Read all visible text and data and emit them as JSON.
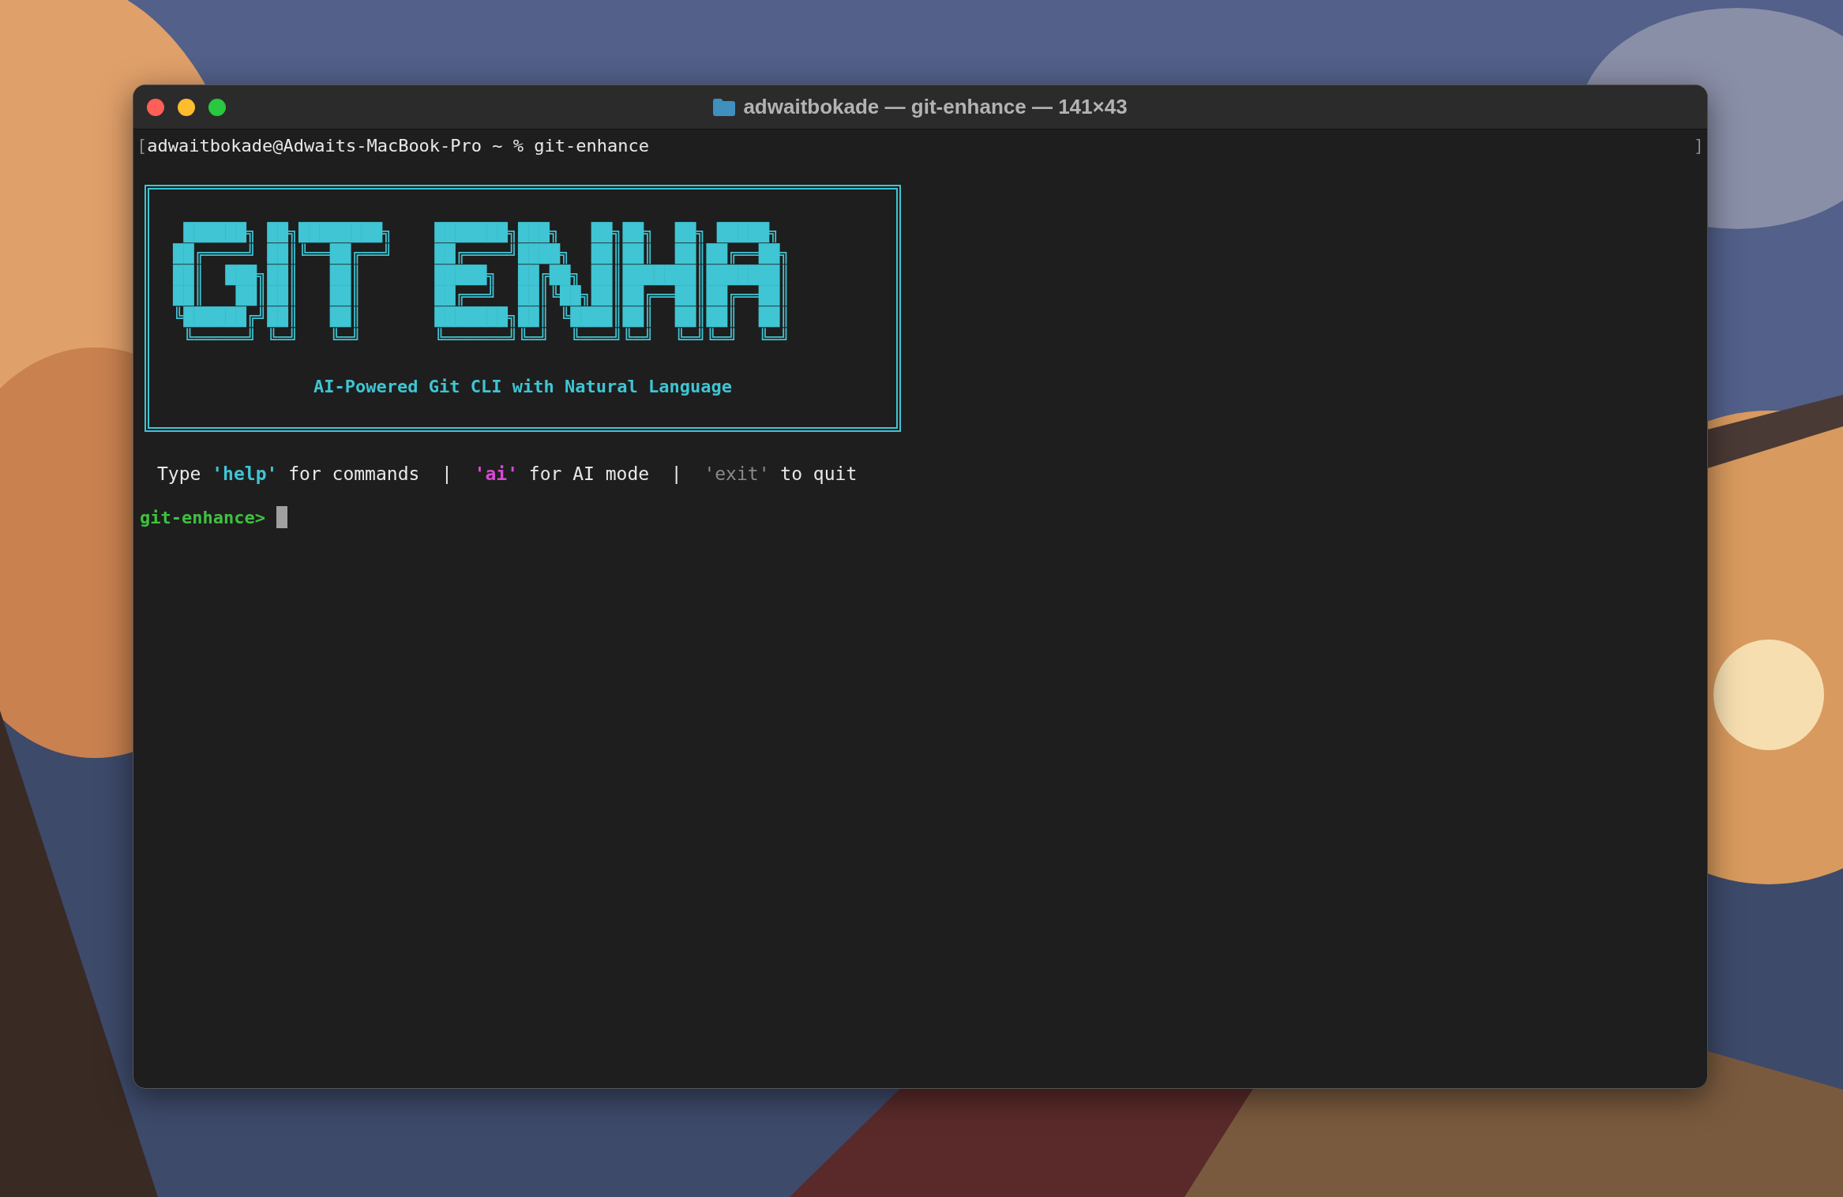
{
  "window": {
    "title": "adwaitbokade — git-enhance — 141×43"
  },
  "command_line": {
    "mark_left": "[",
    "text": "adwaitbokade@Adwaits-MacBook-Pro ~ % git-enhance",
    "mark_right": "]"
  },
  "banner": {
    "art_lines": [
      " ██████╗ ██╗████████╗    ███████╗███╗   ██╗██╗  ██╗ █████╗ ",
      "██╔════╝ ██║╚══██╔══╝    ██╔════╝████╗  ██║██║  ██║██╔══██╗",
      "██║  ███╗██║   ██║       █████╗  ██╔██╗ ██║███████║███████║",
      "██║   ██║██║   ██║       ██╔══╝  ██║╚██╗██║██╔══██║██╔══██║",
      "╚██████╔╝██║   ██║       ███████╗██║ ╚████║██║  ██║██║  ██║",
      " ╚═════╝ ╚═╝   ╚═╝       ╚══════╝╚═╝  ╚═══╝╚═╝  ╚═╝╚═╝  ╚═╝"
    ],
    "subtitle": "AI-Powered Git CLI with Natural Language"
  },
  "hint": [
    {
      "text": "Type ",
      "kind": "plain"
    },
    {
      "text": "'help'",
      "kind": "help"
    },
    {
      "text": " for commands  |  ",
      "kind": "plain"
    },
    {
      "text": "'ai'",
      "kind": "ai"
    },
    {
      "text": " for AI mode  |  ",
      "kind": "plain"
    },
    {
      "text": "'exit'",
      "kind": "dim"
    },
    {
      "text": " to quit",
      "kind": "plain"
    }
  ],
  "prompt": "git-enhance>"
}
